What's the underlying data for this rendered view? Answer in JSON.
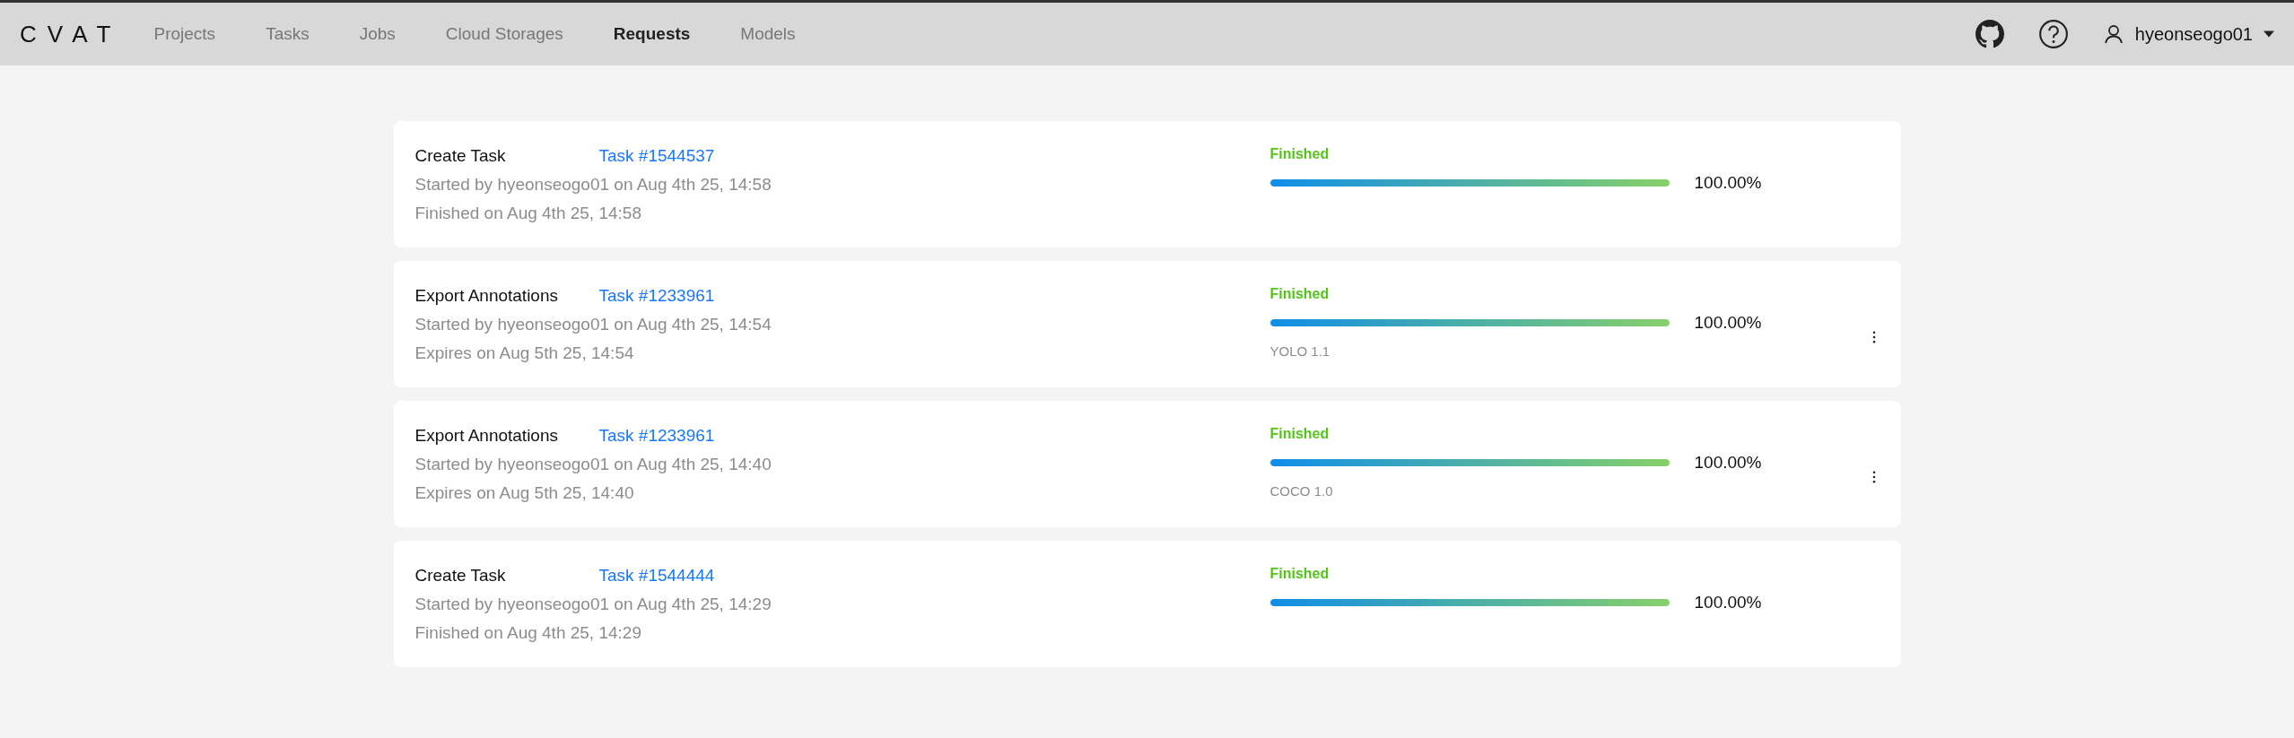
{
  "header": {
    "logo": "CVAT",
    "nav": [
      {
        "label": "Projects",
        "selected": false
      },
      {
        "label": "Tasks",
        "selected": false
      },
      {
        "label": "Jobs",
        "selected": false
      },
      {
        "label": "Cloud Storages",
        "selected": false
      },
      {
        "label": "Requests",
        "selected": true
      },
      {
        "label": "Models",
        "selected": false
      }
    ],
    "user": "hyeonseogo01"
  },
  "requests": [
    {
      "action": "Create Task",
      "target": "Task #1544537",
      "started": "Started by hyeonseogo01 on Aug 4th 25, 14:58",
      "ended": "Finished on Aug 4th 25, 14:58",
      "status": "Finished",
      "level": 1,
      "progress": "100.00%",
      "has_menu": false
    },
    {
      "action": "Export Annotations",
      "target": "Task #1233961",
      "started": "Started by hyeonseogo01 on Aug 4th 25, 14:54",
      "ended": "Expires on Aug 5th 25, 14:54",
      "status": "Finished",
      "level": 1,
      "progress": "100.00%",
      "format": "YOLO 1.1",
      "has_menu": true
    },
    {
      "action": "Export Annotations",
      "target": "Task #1233961",
      "started": "Started by hyeonseogo01 on Aug 4th 25, 14:40",
      "ended": "Expires on Aug 5th 25, 14:40",
      "status": "Finished",
      "level": 1,
      "progress": "100.00%",
      "format": "COCO 1.0",
      "has_menu": true
    },
    {
      "action": "Create Task",
      "target": "Task #1544444",
      "started": "Started by hyeonseogo01 on Aug 4th 25, 14:29",
      "ended": "Finished on Aug 4th 25, 14:29",
      "status": "Finished",
      "level": 1,
      "progress": "100.00%",
      "has_menu": false
    }
  ]
}
